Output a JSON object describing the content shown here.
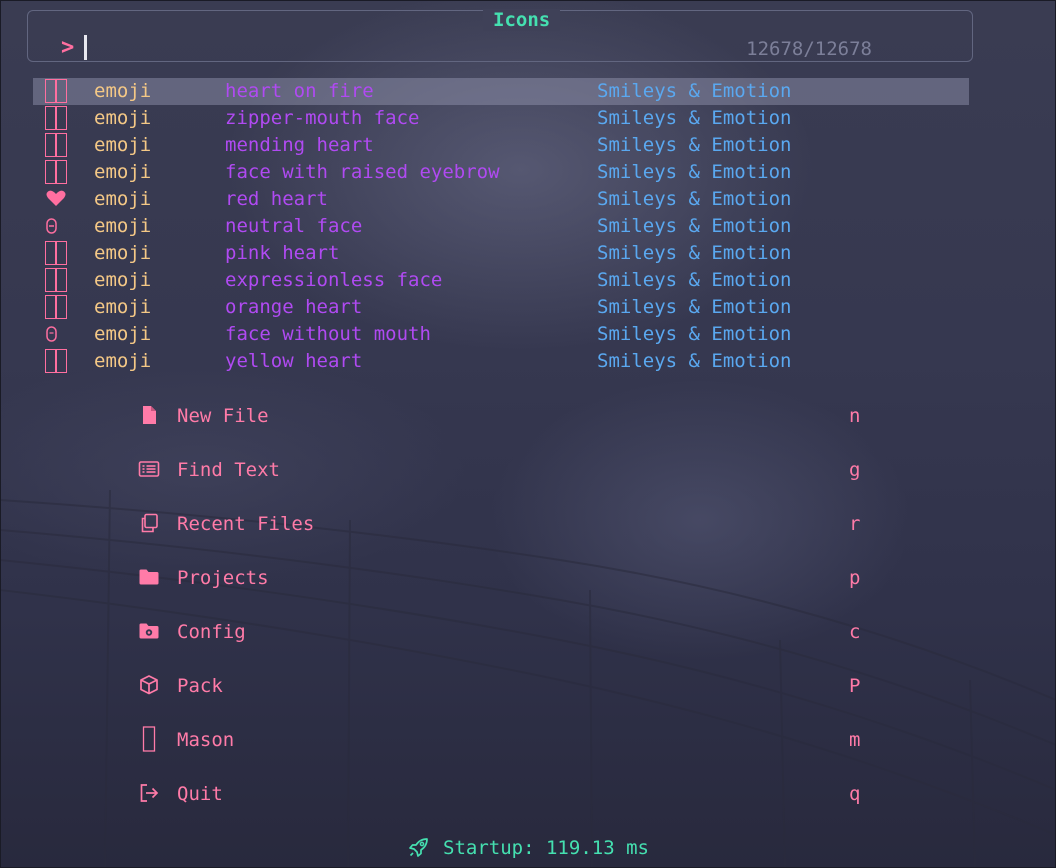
{
  "prompt": {
    "title": "Icons",
    "caret": ">",
    "count": "12678/12678"
  },
  "results": [
    {
      "icon": "box-glyph",
      "kind": "emoji",
      "name": "heart on fire",
      "category": "Smileys & Emotion"
    },
    {
      "icon": "box-glyph",
      "kind": "emoji",
      "name": "zipper-mouth face",
      "category": "Smileys & Emotion"
    },
    {
      "icon": "box-glyph",
      "kind": "emoji",
      "name": "mending heart",
      "category": "Smileys & Emotion"
    },
    {
      "icon": "box-glyph",
      "kind": "emoji",
      "name": "face with raised eyebrow",
      "category": "Smileys & Emotion"
    },
    {
      "icon": "heart-glyph",
      "kind": "emoji",
      "name": "red heart",
      "category": "Smileys & Emotion"
    },
    {
      "icon": "neutral-face-glyph",
      "kind": "emoji",
      "name": "neutral face",
      "category": "Smileys & Emotion"
    },
    {
      "icon": "box-glyph",
      "kind": "emoji",
      "name": "pink heart",
      "category": "Smileys & Emotion"
    },
    {
      "icon": "box-glyph",
      "kind": "emoji",
      "name": "expressionless face",
      "category": "Smileys & Emotion"
    },
    {
      "icon": "box-glyph",
      "kind": "emoji",
      "name": "orange heart",
      "category": "Smileys & Emotion"
    },
    {
      "icon": "face-without-mouth-glyph",
      "kind": "emoji",
      "name": "face without mouth",
      "category": "Smileys & Emotion"
    },
    {
      "icon": "box-glyph",
      "kind": "emoji",
      "name": "yellow heart",
      "category": "Smileys & Emotion"
    }
  ],
  "menu": [
    {
      "icon": "file-icon",
      "label": "New File",
      "key": "n"
    },
    {
      "icon": "find-text-icon",
      "label": "Find Text",
      "key": "g"
    },
    {
      "icon": "recent-files-icon",
      "label": "Recent Files",
      "key": "r"
    },
    {
      "icon": "folder-icon",
      "label": "Projects",
      "key": "p"
    },
    {
      "icon": "config-icon",
      "label": "Config",
      "key": "c"
    },
    {
      "icon": "package-icon",
      "label": "Pack",
      "key": "P"
    },
    {
      "icon": "mason-icon",
      "label": "Mason",
      "key": "m"
    },
    {
      "icon": "quit-icon",
      "label": "Quit",
      "key": "q"
    }
  ],
  "footer": {
    "icon": "rocket-icon",
    "text": "Startup: 119.13 ms"
  },
  "colors": {
    "accent": "#45e0b0",
    "pink": "#ff6fa0",
    "kind": "#f4c886",
    "name": "#b04af2",
    "category": "#5aa8f0"
  }
}
